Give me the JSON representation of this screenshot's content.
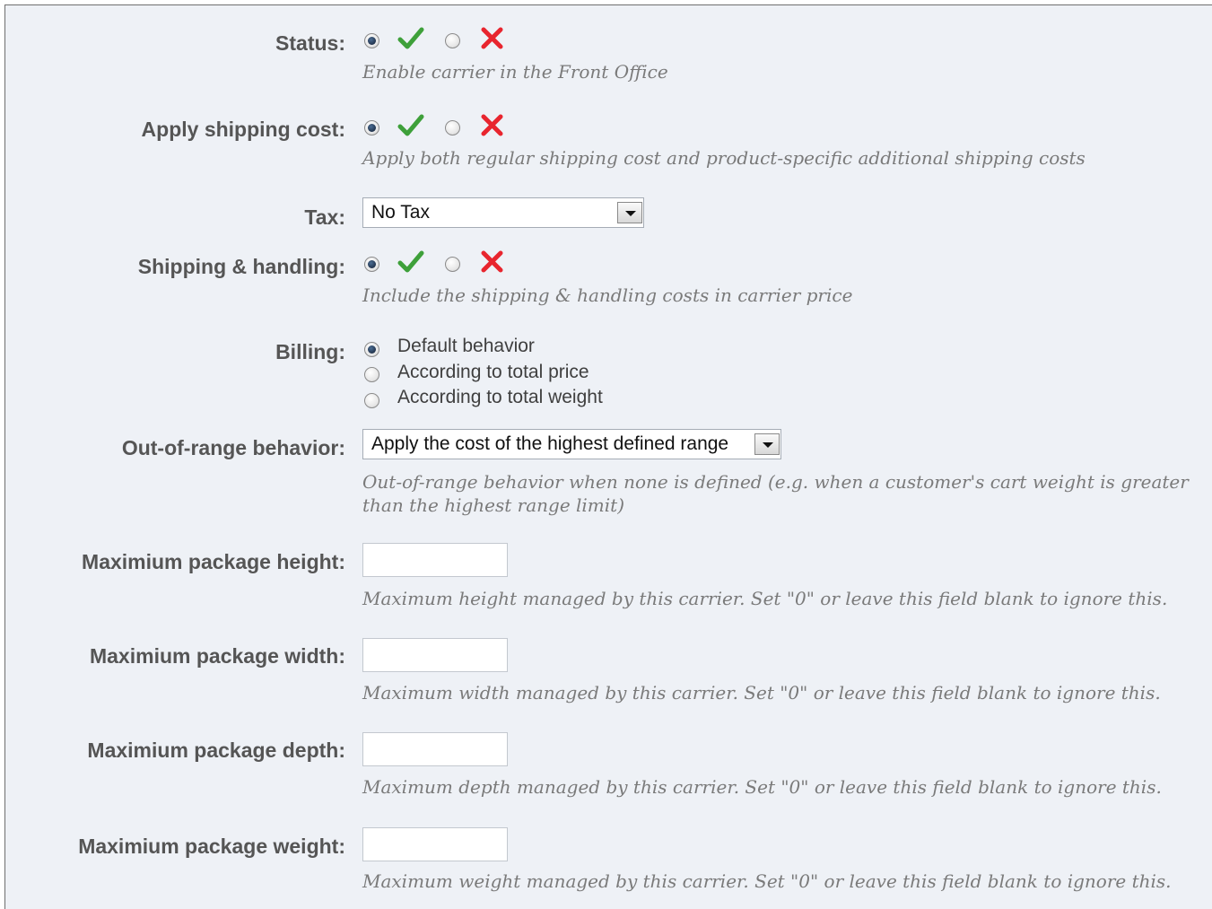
{
  "status": {
    "label": "Status:",
    "hint": "Enable carrier in the Front Office",
    "yes_icon": "check-icon",
    "no_icon": "cross-icon",
    "selected": "yes"
  },
  "apply_shipping_cost": {
    "label": "Apply shipping cost:",
    "hint": "Apply both regular shipping cost and product-specific additional shipping costs",
    "selected": "yes"
  },
  "tax": {
    "label": "Tax:",
    "selected_value": "No Tax"
  },
  "shipping_handling": {
    "label": "Shipping & handling:",
    "hint": "Include the shipping & handling costs in carrier price",
    "selected": "yes"
  },
  "billing": {
    "label": "Billing:",
    "options": [
      {
        "label": "Default behavior",
        "checked": true
      },
      {
        "label": "According to total price",
        "checked": false
      },
      {
        "label": "According to total weight",
        "checked": false
      }
    ]
  },
  "out_of_range": {
    "label": "Out-of-range behavior:",
    "selected_value": "Apply the cost of the highest defined range",
    "hint": "Out-of-range behavior when none is defined (e.g. when a customer's cart weight is greater than the highest range limit)"
  },
  "max_height": {
    "label": "Maximium package height:",
    "value": "",
    "hint": "Maximum height managed by this carrier. Set \"0\" or leave this field blank to ignore this."
  },
  "max_width": {
    "label": "Maximium package width:",
    "value": "",
    "hint": "Maximum width managed by this carrier. Set \"0\" or leave this field blank to ignore this."
  },
  "max_depth": {
    "label": "Maximium package depth:",
    "value": "",
    "hint": "Maximum depth managed by this carrier. Set \"0\" or leave this field blank to ignore this."
  },
  "max_weight": {
    "label": "Maximium package weight:",
    "value": "",
    "hint": "Maximum weight managed by this carrier. Set \"0\" or leave this field blank to ignore this."
  },
  "colors": {
    "background": "#eef1f6",
    "label": "#555555",
    "hint": "#7a7a7a",
    "check": "#3ea03a",
    "cross": "#e8252e"
  }
}
